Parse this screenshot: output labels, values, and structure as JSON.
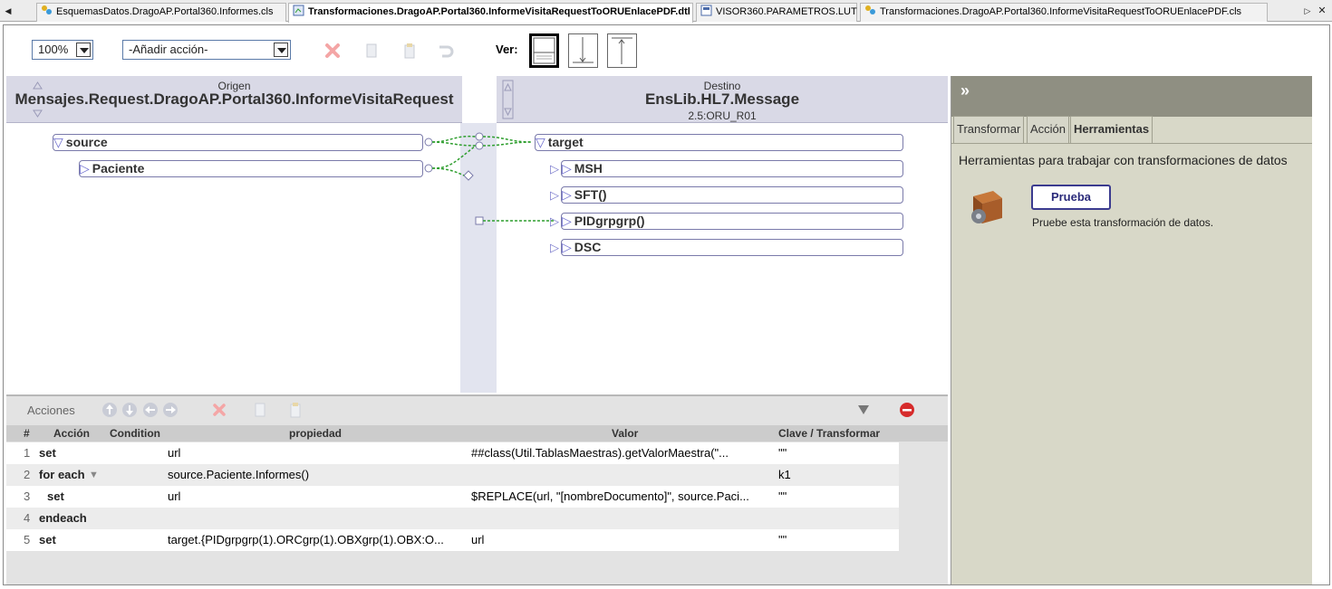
{
  "tabs": [
    {
      "label": "EsquemasDatos.DragoAP.Portal360.Informes.cls",
      "active": false
    },
    {
      "label": "Transformaciones.DragoAP.Portal360.InformeVisitaRequestToORUEnlacePDF.dtl",
      "active": true
    },
    {
      "label": "VISOR360.PARAMETROS.LUT",
      "active": false
    },
    {
      "label": "Transformaciones.DragoAP.Portal360.InformeVisitaRequestToORUEnlacePDF.cls",
      "active": false
    }
  ],
  "tabstrip_controls": {
    "scroll_left": "◀",
    "scroll_right": "▷",
    "close": "✕"
  },
  "toolbar": {
    "zoom": "100%",
    "add_action": "-Añadir acción-",
    "ver_label": "Ver:",
    "icons": [
      "delete-icon",
      "copy-icon",
      "paste-icon",
      "undo-icon"
    ]
  },
  "source": {
    "caption": "Origen",
    "class_name": "Mensajes.Request.DragoAP.Portal360.InformeVisitaRequest",
    "nodes": [
      {
        "label": "source",
        "expanded": true
      },
      {
        "label": "Paciente",
        "expanded": false
      }
    ]
  },
  "target": {
    "caption": "Destino",
    "class_name": "EnsLib.HL7.Message",
    "doc_type": "2.5:ORU_R01",
    "nodes": [
      {
        "label": "target",
        "expanded": true
      },
      {
        "label": "MSH",
        "expanded": false
      },
      {
        "label": "SFT()",
        "expanded": false
      },
      {
        "label": "PIDgrpgrp()",
        "expanded": false
      },
      {
        "label": "DSC",
        "expanded": false
      }
    ]
  },
  "actions": {
    "title": "Acciones",
    "columns": [
      "#",
      "Acción",
      "Condition",
      "propiedad",
      "Valor",
      "Clave / Transformar"
    ],
    "rows": [
      {
        "num": "1",
        "action": "set",
        "condition": "",
        "property": "url",
        "value": "##class(Util.TablasMaestras).getValorMaestra(\"...",
        "key": "\"\""
      },
      {
        "num": "2",
        "action": "for each",
        "condition": "",
        "property": "source.Paciente.Informes()",
        "value": "",
        "key": "k1"
      },
      {
        "num": "3",
        "action": "set",
        "condition": "",
        "property": "url",
        "value": "$REPLACE(url, \"[nombreDocumento]\", source.Paci...",
        "key": "\"\""
      },
      {
        "num": "4",
        "action": "endeach",
        "condition": "",
        "property": "",
        "value": "",
        "key": ""
      },
      {
        "num": "5",
        "action": "set",
        "condition": "",
        "property": "target.{PIDgrpgrp(1).ORCgrp(1).OBXgrp(1).OBX:O...",
        "value": "url",
        "key": "\"\""
      }
    ]
  },
  "side_panel": {
    "collapse": "»",
    "tabs": [
      {
        "label": "Transformar",
        "active": false
      },
      {
        "label": "Acción",
        "active": false
      },
      {
        "label": "Herramientas",
        "active": true
      }
    ],
    "description": "Herramientas para trabajar con transformaciones de datos",
    "test_button": "Prueba",
    "test_help": "Pruebe esta transformación de datos."
  },
  "colors": {
    "link_green": "#2e9e2e",
    "node_border": "#7a7aaa",
    "header_bg": "#d9d9e6"
  }
}
